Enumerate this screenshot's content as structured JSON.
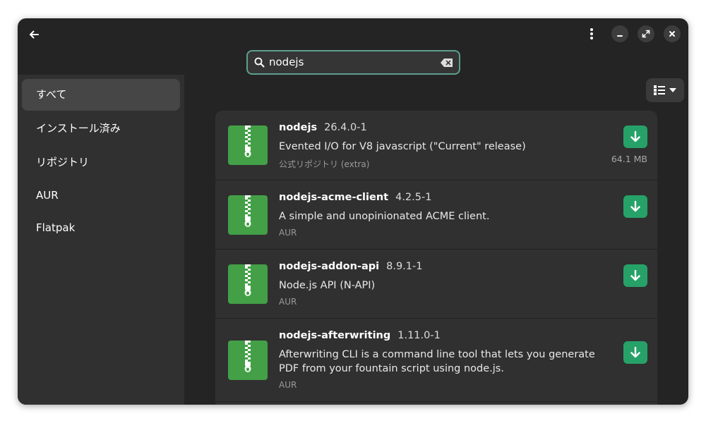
{
  "search": {
    "value": "nodejs"
  },
  "sidebar": {
    "items": [
      {
        "label": "すべて",
        "active": true
      },
      {
        "label": "インストール済み"
      },
      {
        "label": "リポジトリ"
      },
      {
        "label": "AUR"
      },
      {
        "label": "Flatpak"
      }
    ]
  },
  "icons": {
    "back": "arrow-left-icon",
    "menu": "kebab-menu-icon",
    "minimize": "minimize-icon",
    "maximize": "maximize-icon",
    "close": "close-icon",
    "search": "search-icon",
    "clear": "backspace-clear-icon",
    "view": "list-view-icon",
    "package": "zip-archive-icon",
    "download": "download-arrow-icon"
  },
  "colors": {
    "accent": "#26a269",
    "package_icon": "#43a047",
    "search_border": "#5e9e8e"
  },
  "packages": [
    {
      "name": "nodejs",
      "version": "26.4.0-1",
      "description": "Evented I/O for V8 javascript (\"Current\" release)",
      "source": "公式リポジトリ (extra)",
      "size": "64.1 MB"
    },
    {
      "name": "nodejs-acme-client",
      "version": "4.2.5-1",
      "description": "A simple and unopinionated ACME client.",
      "source": "AUR"
    },
    {
      "name": "nodejs-addon-api",
      "version": "8.9.1-1",
      "description": "Node.js API (N-API)",
      "source": "AUR"
    },
    {
      "name": "nodejs-afterwriting",
      "version": "1.11.0-1",
      "description": "Afterwriting CLI is a command line tool that lets you generate PDF from your fountain script using node.js.",
      "source": "AUR"
    }
  ]
}
